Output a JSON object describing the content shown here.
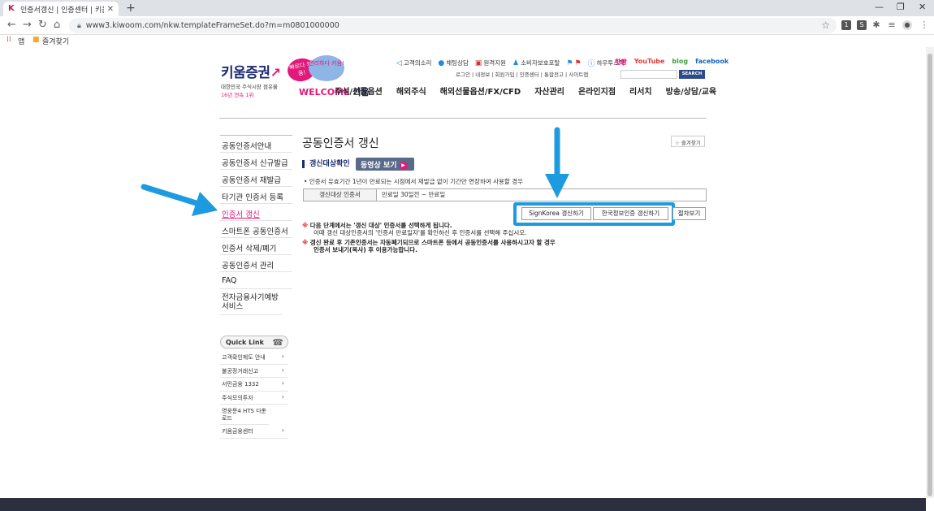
{
  "browser": {
    "tab_title": "인증서갱신 | 인증센터 | 키움증권",
    "new_tab": "+",
    "url": "www3.kiwoom.com/nkw.templateFrameSet.do?m=m0801000000",
    "bookmarks": {
      "apps_label": "앱",
      "favorites_label": "즐겨찾기"
    }
  },
  "header": {
    "logo_text": "키움증권",
    "logo_sub1": "대한민국 주식시장 점유율",
    "logo_sub2": "16년 연속 1위",
    "bubble1": "빠르다 키움!",
    "bubble2": "편리하다 키움!",
    "welcome": "WELCOME",
    "welcome_brand": "키움",
    "top_links": [
      "고객의소리",
      "채팅상담",
      "원격지원",
      "소비자보호포탈",
      "하우투스탁"
    ],
    "sns": {
      "talk": "핫빵",
      "youtube": "YouTube",
      "blog": "blog",
      "facebook": "facebook"
    },
    "sub_links": "로그인 | 내정보 | 회원가입 | 인증센터 | 통합전고 | 사이트맵",
    "search_button": "SEARCH",
    "gnb": [
      "주식/선물옵션",
      "해외주식",
      "해외선물옵션/FX/CFD",
      "자산관리",
      "온라인지점",
      "리서치",
      "방송/상담/교육"
    ]
  },
  "lnb": {
    "items": [
      "공동인증서안내",
      "공동인증서 신규발급",
      "공동인증서 재발급",
      "타기관 인증서 등록",
      "인증서 갱신",
      "스마트폰 공동인증서",
      "인증서 삭제/폐기",
      "공동인증서 관리",
      "FAQ",
      "전자금융사기예방 서비스"
    ],
    "active_index": 4
  },
  "quick_link": {
    "title": "Quick Link",
    "items": [
      "고객확인제도 안내",
      "불공정거래신고",
      "서민금융 1332",
      "주식모의투자",
      "영웅문4 HTS 다운로드",
      "키움금융센터"
    ]
  },
  "content": {
    "title": "공동인증서 갱신",
    "favorite_button": "즐겨찾기",
    "section_title": "갱신대상확인",
    "video_button": "동영상 보기",
    "note": "• 인증서 유효기간 1년이 만료되는 시점에서 재발급 없이 기간만 연장하여 사용할 경우",
    "table": {
      "th": "갱신대상 인증서",
      "td": "만료일 30일전 ~ 만료일"
    },
    "buttons": {
      "signkorea": "SignKorea 갱신하기",
      "kica": "한국정보인증 갱신하기",
      "next": "절차보기"
    },
    "warnings": [
      {
        "mark": "※",
        "bold": "다음 단계에서는 '갱신 대상' 인증서를 선택하게 됩니다.",
        "detail": "이때 갱신 대상인증서의 '인증서 만료일자'를 확인하신 후 인증서를 선택해 주십시오."
      },
      {
        "mark": "※",
        "bold": "갱신 완료 후 기존인증서는 자동폐기되므로 스마트폰 등에서 공동인증서를 사용하시고자 할 경우",
        "detail": "인증서 보내기(복사) 후 이용가능합니다."
      }
    ]
  },
  "colors": {
    "accent": "#e2187a",
    "brand": "#1b2b73",
    "annotation": "#1e9be0"
  }
}
